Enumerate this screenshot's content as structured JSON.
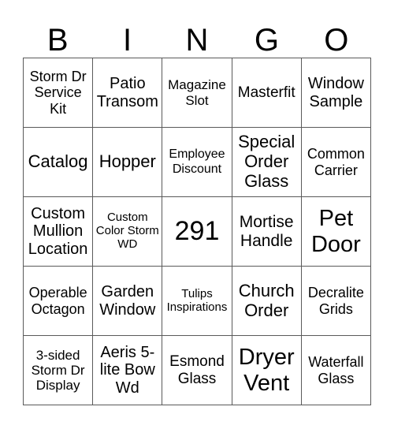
{
  "header": {
    "letters": [
      "B",
      "I",
      "N",
      "G",
      "O"
    ]
  },
  "card": {
    "rows": [
      [
        "Storm Dr Service Kit",
        "Patio Transom",
        "Magazine Slot",
        "Masterfit",
        "Window Sample"
      ],
      [
        "Catalog",
        "Hopper",
        "Employee Discount",
        "Special Order Glass",
        "Common Carrier"
      ],
      [
        "Custom Mullion Location",
        "Custom Color Storm WD",
        "291",
        "Mortise Handle",
        "Pet Door"
      ],
      [
        "Operable Octagon",
        "Garden Window",
        "Tulips Inspirations",
        "Church Order",
        "Decralite Grids"
      ],
      [
        "3-sided Storm Dr Display",
        "Aeris 5-lite Bow Wd",
        "Esmond Glass",
        "Dryer Vent",
        "Waterfall Glass"
      ]
    ]
  },
  "colors": {
    "grid_line": "#5a5a5a",
    "text": "#000000",
    "background": "#ffffff"
  }
}
